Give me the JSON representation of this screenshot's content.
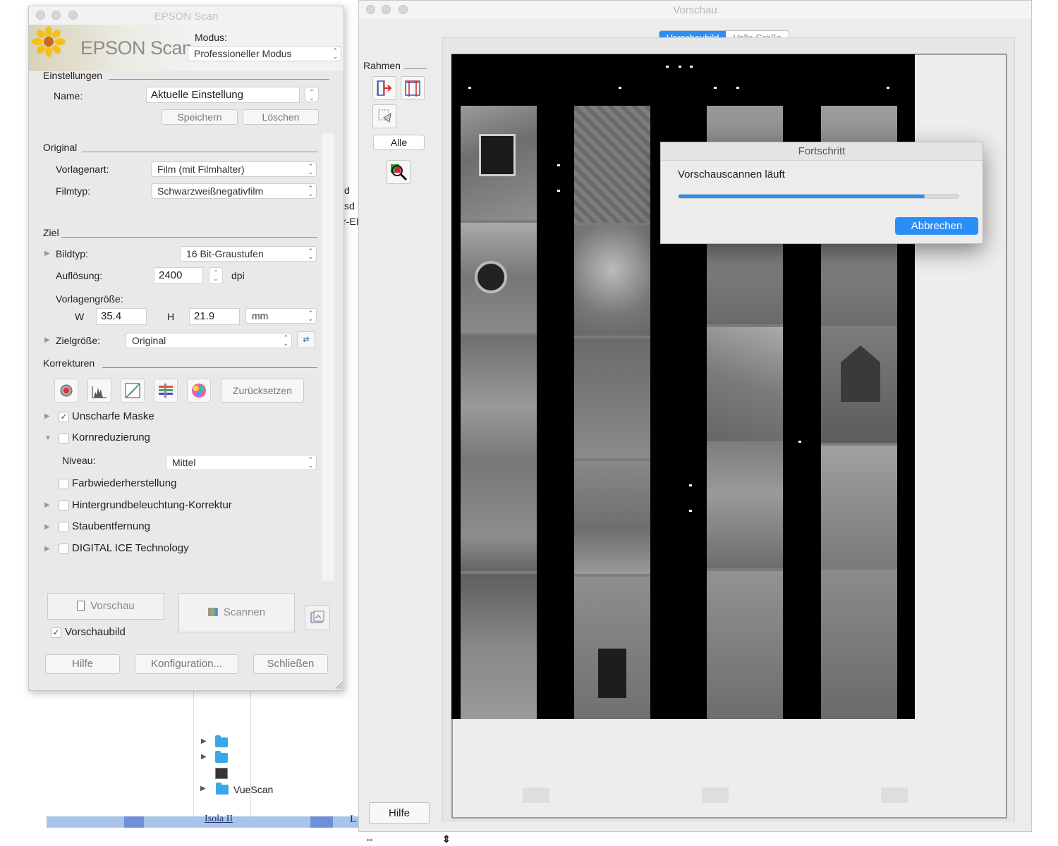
{
  "epson_window": {
    "title": "EPSON Scan",
    "logo": "EPSON Scan",
    "mode_label": "Modus:",
    "mode_value": "Professioneller Modus",
    "settings": {
      "section": "Einstellungen",
      "name_label": "Name:",
      "name_value": "Aktuelle Einstellung",
      "save_label": "Speichern",
      "delete_label": "Löschen"
    },
    "original": {
      "section": "Original",
      "doc_type_label": "Vorlagenart:",
      "doc_type_value": "Film (mit Filmhalter)",
      "film_type_label": "Filmtyp:",
      "film_type_value": "Schwarzweißnegativfilm"
    },
    "target": {
      "section": "Ziel",
      "image_type_label": "Bildtyp:",
      "image_type_value": "16 Bit-Graustufen",
      "resolution_label": "Auflösung:",
      "resolution_value": "2400",
      "resolution_unit": "dpi",
      "doc_size_label": "Vorlagengröße:",
      "w_label": "W",
      "w_value": "35.4",
      "h_label": "H",
      "h_value": "21.9",
      "unit_value": "mm",
      "target_size_label": "Zielgröße:",
      "target_size_value": "Original"
    },
    "corrections": {
      "section": "Korrekturen",
      "reset_label": "Zurücksetzen",
      "unsharp_mask": "Unscharfe Maske",
      "grain_reduction": "Kornreduzierung",
      "level_label": "Niveau:",
      "level_value": "Mittel",
      "color_restoration": "Farbwiederherstellung",
      "backlight_correction": "Hintergrundbeleuchtung-Korrektur",
      "dust_removal": "Staubentfernung",
      "digital_ice": "DIGITAL ICE Technology"
    },
    "preview_button": "Vorschau",
    "scan_button": "Scannen",
    "thumbnail_label": "Vorschaubild",
    "help_button": "Hilfe",
    "config_button": "Konfiguration...",
    "close_button": "Schließen"
  },
  "preview_window": {
    "title": "Vorschau",
    "tabs": [
      "Vorschaubild",
      "Volle Größe"
    ],
    "frame_label": "Rahmen",
    "all_button": "Alle",
    "help_button": "Hilfe"
  },
  "progress_dialog": {
    "title": "Fortschritt",
    "message": "Vorschauscannen läuft",
    "progress": 0.88,
    "cancel_button": "Abbrechen"
  },
  "background": {
    "clipped_texts": [
      "d",
      "sd",
      "r-EI"
    ],
    "finder_item": "VueScan",
    "dock_text": "Isola II",
    "dock_letter": "L"
  },
  "colors": {
    "accent": "#2c8ef1",
    "window_bg": "#ececec",
    "film_bg": "#000000"
  }
}
